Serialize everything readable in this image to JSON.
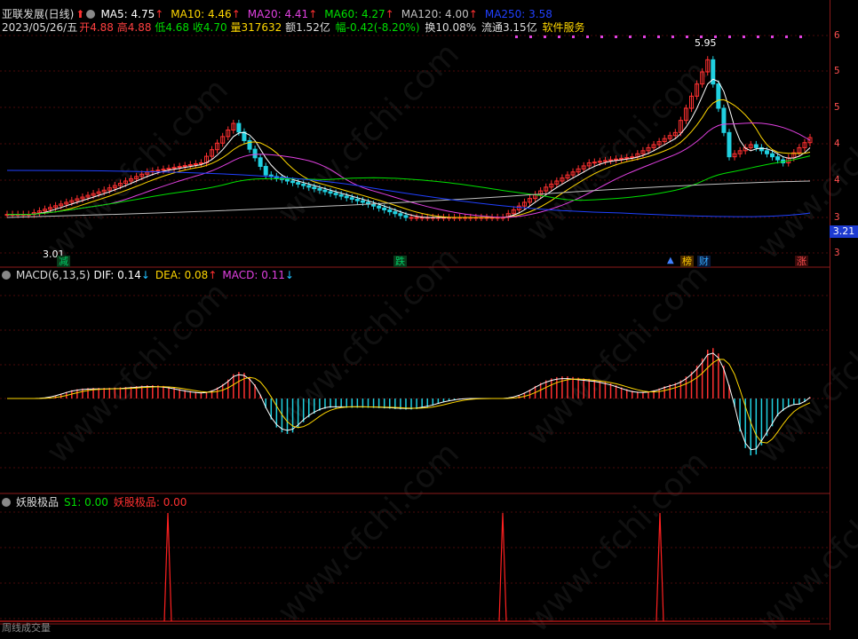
{
  "stock": {
    "name": "亚联发展(日线)",
    "ma": [
      {
        "label": "MA5: 4.75",
        "color": "#ffffff",
        "arrow": "↑",
        "arrow_color": "#ff3030"
      },
      {
        "label": "MA10: 4.46",
        "color": "#ffd700",
        "arrow": "↑",
        "arrow_color": "#ff3030"
      },
      {
        "label": "MA20: 4.41",
        "color": "#e040e0",
        "arrow": "↑",
        "arrow_color": "#ff3030"
      },
      {
        "label": "MA60: 4.27",
        "color": "#00e000",
        "arrow": "↑",
        "arrow_color": "#ff3030"
      },
      {
        "label": "MA120: 4.00",
        "color": "#c0c0c0",
        "arrow": "↑",
        "arrow_color": "#ff3030"
      },
      {
        "label": "MA250: 3.58",
        "color": "#2040ff",
        "arrow": "",
        "arrow_color": "#ff3030"
      }
    ],
    "info": {
      "date": "2023/05/26/五",
      "open": "开4.88",
      "high": "高4.88",
      "low": "低4.68",
      "close": "收4.70",
      "volume": "量317632",
      "amount": "额1.52亿",
      "change": "幅-0.42(-8.20%)",
      "turnover": "换10.08%",
      "float": "流通3.15亿",
      "sector": "软件服务"
    },
    "high_label": "5.95",
    "low_label": "3.01",
    "current_price": "3.21"
  },
  "price_axis": [
    "6",
    "5",
    "5",
    "4",
    "4",
    "3",
    "3"
  ],
  "macd_axis": [
    "",
    "",
    "",
    "",
    "",
    "",
    ""
  ],
  "macd": {
    "title": "MACD(6,13,5)",
    "dif": "DIF: 0.14",
    "dif_arrow": "↓",
    "dea": "DEA: 0.08",
    "dea_arrow": "↑",
    "macd": "MACD: 0.11",
    "macd_arrow": "↓"
  },
  "yaogu": {
    "title": "妖股极品",
    "s1": "S1: 0.00",
    "val": "妖股极品: 0.00"
  },
  "badges": [
    {
      "text": "减",
      "color": "#00cc66",
      "bg": "#0a3a1a"
    },
    {
      "text": "跌",
      "color": "#00cc66",
      "bg": "#0a3a1a"
    },
    {
      "text": "榜",
      "color": "#ffcc00",
      "bg": "#4a2a00"
    },
    {
      "text": "财",
      "color": "#33aaff",
      "bg": "#0a1a3a"
    },
    {
      "text": "涨",
      "color": "#ff5050",
      "bg": "#3a0a0a"
    }
  ],
  "watermark": "www.cfchi.com",
  "bottom_line": "周线成交量"
}
